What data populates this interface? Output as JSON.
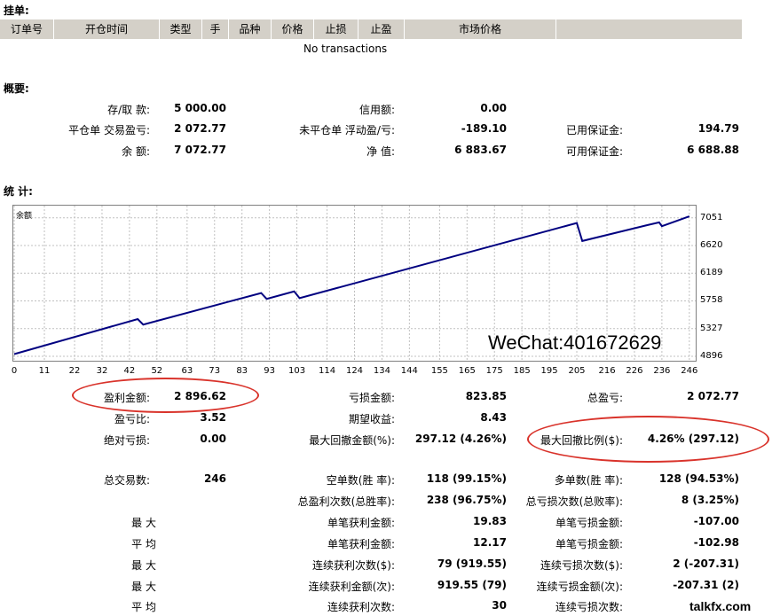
{
  "pending": {
    "title": "挂单:",
    "columns": [
      "订单号",
      "开仓时间",
      "类型",
      "手",
      "品种",
      "价格",
      "止损",
      "止盈",
      "市场价格"
    ],
    "empty_text": "No transactions"
  },
  "summary": {
    "title": "概要:",
    "deposit_label": "存/取 款:",
    "deposit": "5 000.00",
    "credit_label": "信用额:",
    "credit": "0.00",
    "closed_pl_label": "平仓单 交易盈亏:",
    "closed_pl": "2 072.77",
    "floating_label": "未平仓单 浮动盈/亏:",
    "floating": "-189.10",
    "margin_label": "已用保证金:",
    "margin": "194.79",
    "balance_label": "余 额:",
    "balance": "7 072.77",
    "equity_label": "净 值:",
    "equity": "6 883.67",
    "free_margin_label": "可用保证金:",
    "free_margin": "6 688.88"
  },
  "stats": {
    "title": "统 计:",
    "gross_profit_label": "盈利金额:",
    "gross_profit": "2 896.62",
    "gross_loss_label": "亏损金额:",
    "gross_loss": "823.85",
    "total_pl_label": "总盈亏:",
    "total_pl": "2 072.77",
    "profit_factor_label": "盈亏比:",
    "profit_factor": "3.52",
    "expected_label": "期望收益:",
    "expected": "8.43",
    "abs_dd_label": "绝对亏损:",
    "abs_dd": "0.00",
    "max_dd_label": "最大回撤金额(%):",
    "max_dd": "297.12 (4.26%)",
    "rel_dd_label": "最大回撤比例($):",
    "rel_dd": "4.26% (297.12)",
    "total_trades_label": "总交易数:",
    "total_trades": "246",
    "short_label": "空单数(胜 率):",
    "short": "118 (99.15%)",
    "long_label": "多单数(胜 率):",
    "long": "128 (94.53%)",
    "profit_trades_label": "总盈利次数(总胜率):",
    "profit_trades": "238 (96.75%)",
    "loss_trades_label": "总亏损次数(总败率):",
    "loss_trades": "8 (3.25%)",
    "largest_label": "最 大",
    "largest_profit_label": "单笔获利金额:",
    "largest_profit": "19.83",
    "largest_loss_label": "单笔亏损金额:",
    "largest_loss": "-107.00",
    "average_label": "平 均",
    "avg_profit_label": "单笔获利金额:",
    "avg_profit": "12.17",
    "avg_loss_label": "单笔亏损金额:",
    "avg_loss": "-102.98",
    "max_label": "最 大",
    "max_consec_wins_label": "连续获利次数($):",
    "max_consec_wins": "79 (919.55)",
    "max_consec_losses_label": "连续亏损次数($):",
    "max_consec_losses": "2 (-207.31)",
    "max2_label": "最 大",
    "max_consec_profit_label": "连续获利金额(次):",
    "max_consec_profit": "919.55 (79)",
    "max_consec_loss_label": "连续亏损金额(次):",
    "max_consec_loss": "-207.31 (2)",
    "avg2_label": "平 均",
    "avg_consec_wins_label": "连续获利次数:",
    "avg_consec_wins": "30",
    "avg_consec_losses_label": "连续亏损次数:"
  },
  "chart_data": {
    "type": "line",
    "title": "",
    "series": [
      {
        "name": "余额",
        "x": [
          0,
          45,
          47,
          90,
          92,
          102,
          104,
          205,
          207,
          230,
          235,
          236,
          246
        ],
        "values": [
          4930,
          5475,
          5390,
          5880,
          5790,
          5905,
          5800,
          6970,
          6690,
          6930,
          6980,
          6920,
          7073
        ]
      }
    ],
    "y_ticks": [
      4896,
      5327,
      5758,
      6189,
      6620,
      7051
    ],
    "x_ticks": [
      0,
      11,
      22,
      32,
      42,
      52,
      63,
      73,
      83,
      93,
      103,
      114,
      124,
      134,
      144,
      155,
      165,
      175,
      185,
      195,
      205,
      216,
      226,
      236,
      246
    ],
    "xlim": [
      0,
      248
    ],
    "ylim": [
      4896,
      7130
    ],
    "grid": true,
    "color": "#000080"
  },
  "watermark": {
    "wechat": "WeChat:401672629",
    "logo": "talkfx.com"
  },
  "colors": {
    "header_bg": "#d4d0c8",
    "highlight": "#d9332b",
    "line": "#000080"
  }
}
